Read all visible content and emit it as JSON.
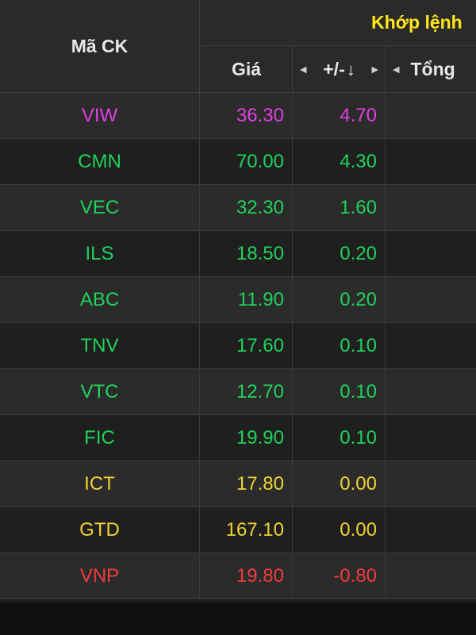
{
  "header": {
    "symbol_label": "Mã CK",
    "group_label": "Khớp lệnh",
    "price_label": "Giá",
    "change_label": "+/-",
    "total_label": "Tổng"
  },
  "colors": {
    "ceiling": "#e040e0",
    "up": "#1fd35a",
    "reference": "#f0d232",
    "down": "#f23a3a",
    "group_header": "#ffe81a"
  },
  "rows": [
    {
      "symbol": "VIW",
      "price": "36.30",
      "change": "4.70",
      "status": "ceiling"
    },
    {
      "symbol": "CMN",
      "price": "70.00",
      "change": "4.30",
      "status": "up"
    },
    {
      "symbol": "VEC",
      "price": "32.30",
      "change": "1.60",
      "status": "up"
    },
    {
      "symbol": "ILS",
      "price": "18.50",
      "change": "0.20",
      "status": "up"
    },
    {
      "symbol": "ABC",
      "price": "11.90",
      "change": "0.20",
      "status": "up"
    },
    {
      "symbol": "TNV",
      "price": "17.60",
      "change": "0.10",
      "status": "up"
    },
    {
      "symbol": "VTC",
      "price": "12.70",
      "change": "0.10",
      "status": "up"
    },
    {
      "symbol": "FIC",
      "price": "19.90",
      "change": "0.10",
      "status": "up"
    },
    {
      "symbol": "ICT",
      "price": "17.80",
      "change": "0.00",
      "status": "reference"
    },
    {
      "symbol": "GTD",
      "price": "167.10",
      "change": "0.00",
      "status": "reference"
    },
    {
      "symbol": "VNP",
      "price": "19.80",
      "change": "-0.80",
      "status": "down"
    }
  ]
}
